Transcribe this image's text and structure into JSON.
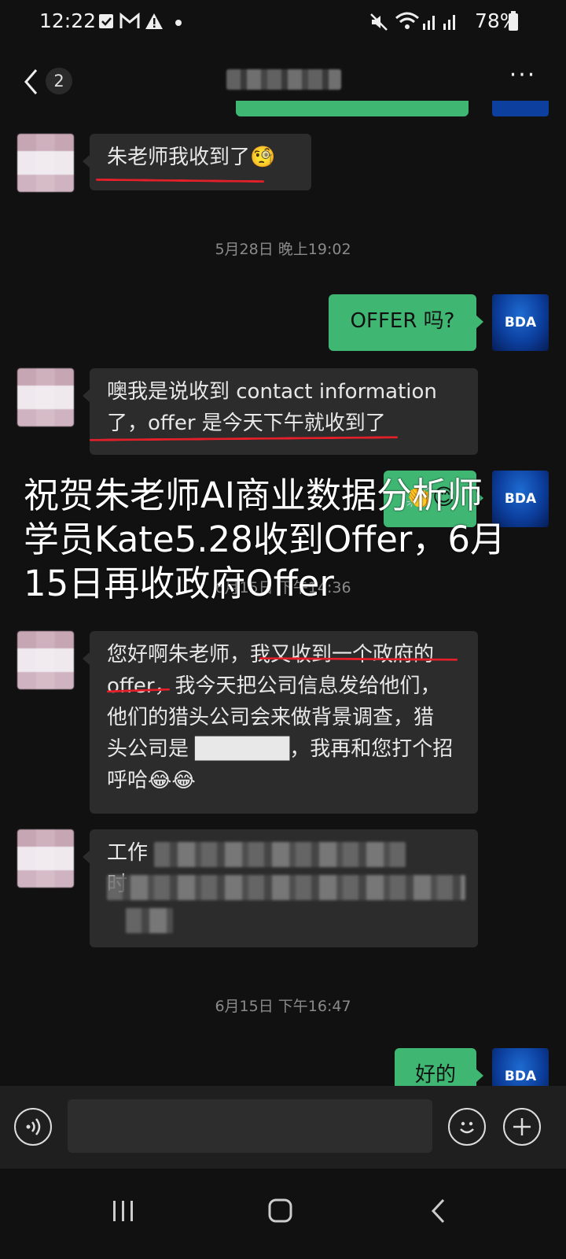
{
  "status_bar": {
    "time": "12:22",
    "battery": "78%",
    "icons": [
      "checkbox-icon",
      "gmail-icon",
      "warning-icon",
      "dot-icon",
      "mute-icon",
      "wifi-icon",
      "signal-icon",
      "battery-icon"
    ]
  },
  "header": {
    "unread_count": "2",
    "more_label": "···"
  },
  "messages": [
    {
      "id": "m1",
      "side": "left",
      "text": "朱老师我收到了",
      "emoji": "🧐"
    },
    {
      "id": "t1",
      "type": "timestamp",
      "text": "5月28日 晚上19:02"
    },
    {
      "id": "m2",
      "side": "right",
      "text": "OFFER 吗?",
      "avatar_label": "BDA"
    },
    {
      "id": "m3",
      "side": "left",
      "lines": [
        "噢我是说收到 contact information",
        "了，offer 是今天下午就收到了"
      ]
    },
    {
      "id": "m4",
      "side": "right",
      "text": "👏😊",
      "avatar_label": "BDA"
    },
    {
      "id": "t2",
      "type": "timestamp",
      "text": "6月15日 下午14:36"
    },
    {
      "id": "m5",
      "side": "left",
      "lines": [
        "您好啊朱老师，我又收到一个政府的",
        "offer，我今天把公司信息发给他们，",
        "他们的猎头公司会来做背景调查，猎",
        "头公司是 ██████，我再和您打个招",
        "呼哈😂😂"
      ]
    },
    {
      "id": "m6",
      "side": "left",
      "lines": [
        "工作",
        "",
        "时"
      ]
    },
    {
      "id": "t3",
      "type": "timestamp",
      "text": "6月15日 下午16:47"
    },
    {
      "id": "m7",
      "side": "right",
      "text": "好的",
      "avatar_label": "BDA"
    }
  ],
  "overlay_caption": [
    "祝贺朱老师AI商业数据分析师",
    "学员Kate5.28收到Offer，6月",
    "15日再收政府Offer"
  ],
  "input_bar": {
    "placeholder": ""
  },
  "colors": {
    "background": "#111111",
    "incoming_bubble": "#2c2c2c",
    "outgoing_bubble": "#3fb773",
    "annotation_red": "#e3202a"
  }
}
